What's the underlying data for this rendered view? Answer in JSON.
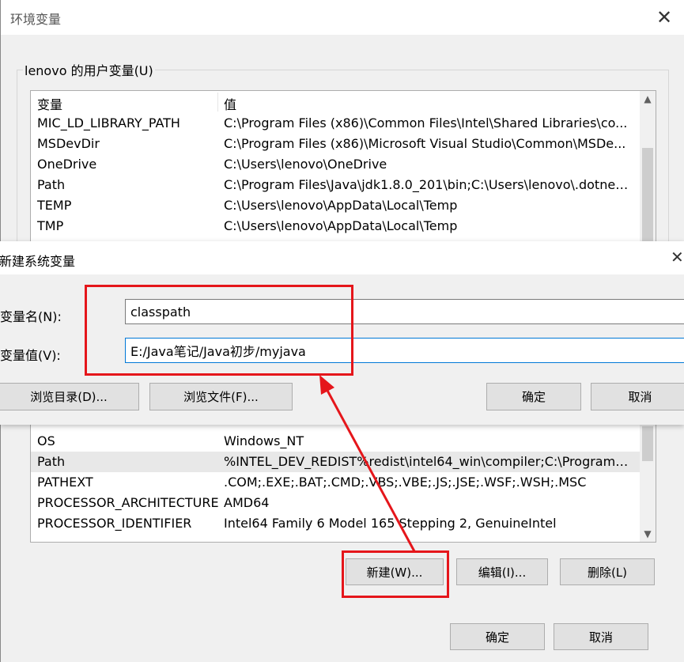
{
  "env_window": {
    "title": "环境变量",
    "close_icon": "✕",
    "user_group_label": "lenovo 的用户变量(U)",
    "columns": {
      "name": "变量",
      "value": "值"
    },
    "user_rows": [
      {
        "name": "MIC_LD_LIBRARY_PATH",
        "value": "C:\\Program Files (x86)\\Common Files\\Intel\\Shared Libraries\\co..."
      },
      {
        "name": "MSDevDir",
        "value": "C:\\Program Files (x86)\\Microsoft Visual Studio\\Common\\MSDe..."
      },
      {
        "name": "OneDrive",
        "value": "C:\\Users\\lenovo\\OneDrive"
      },
      {
        "name": "Path",
        "value": "C:\\Program Files\\Java\\jdk1.8.0_201\\bin;C:\\Users\\lenovo\\.dotnet..."
      },
      {
        "name": "TEMP",
        "value": "C:\\Users\\lenovo\\AppData\\Local\\Temp"
      },
      {
        "name": "TMP",
        "value": "C:\\Users\\lenovo\\AppData\\Local\\Temp"
      }
    ],
    "system_rows": [
      {
        "name": "OS",
        "value": "Windows_NT"
      },
      {
        "name": "Path",
        "value": "%INTEL_DEV_REDIST%redist\\intel64_win\\compiler;C:\\Program F..."
      },
      {
        "name": "PATHEXT",
        "value": ".COM;.EXE;.BAT;.CMD;.VBS;.VBE;.JS;.JSE;.WSF;.WSH;.MSC"
      },
      {
        "name": "PROCESSOR_ARCHITECTURE",
        "value": "AMD64"
      },
      {
        "name": "PROCESSOR_IDENTIFIER",
        "value": "Intel64 Family 6 Model 165 Stepping 2, GenuineIntel"
      }
    ],
    "system_buttons": {
      "new": "新建(W)...",
      "edit": "编辑(I)...",
      "delete": "删除(L)"
    },
    "footer_buttons": {
      "ok": "确定",
      "cancel": "取消"
    }
  },
  "new_dialog": {
    "title": "新建系统变量",
    "close_icon": "✕",
    "name_label": "变量名(N):",
    "value_label": "变量值(V):",
    "name_value": "classpath",
    "value_value": "E:/Java笔记/Java初步/myjava",
    "browse_dir": "浏览目录(D)...",
    "browse_file": "浏览文件(F)...",
    "ok": "确定",
    "cancel": "取消"
  },
  "colors": {
    "annotation": "#e5161b",
    "focus_border": "#0078d7"
  }
}
